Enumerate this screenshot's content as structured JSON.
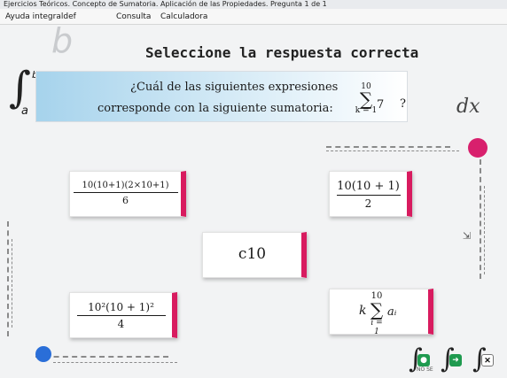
{
  "window": {
    "title": "Ejercicios Teóricos. Concepto de Sumatoria. Aplicación de las Propiedades. Pregunta 1 de 1"
  },
  "menu": {
    "items": [
      "Ayuda integraldef",
      "Consulta",
      "Calculadora"
    ]
  },
  "decor": {
    "letter_b": "b",
    "integral_lower": "a",
    "integral_upper": "b",
    "dx": "dx"
  },
  "header": "Seleccione la respuesta correcta",
  "question": {
    "line1": "¿Cuál de las siguientes expresiones",
    "line2": "corresponde con la siguiente sumatoria:",
    "sum_upper": "10",
    "sum_symbol": "∑",
    "sum_lower": "k = 1",
    "sum_term": "7",
    "mark": "?"
  },
  "options": [
    {
      "numerator": "10(10+1)(2×10+1)",
      "denominator": "6"
    },
    {
      "numerator": "10(10 + 1)",
      "denominator": "2"
    },
    {
      "text": "c10"
    },
    {
      "numerator": "10²(10 + 1)²",
      "denominator": "4"
    },
    {
      "prefix": "k",
      "upper": "10",
      "symbol": "∑",
      "lower": "i = 1",
      "term": "aᵢ"
    }
  ],
  "footer": {
    "buttons": [
      {
        "name": "check",
        "badge": "●"
      },
      {
        "name": "next",
        "badge": "➜"
      },
      {
        "name": "close",
        "badge": "✕"
      }
    ],
    "sub_label": "NO SE"
  },
  "colors": {
    "accent": "#d81b5f",
    "question_bg": "#a6d3ec",
    "blue_dot": "#2a6ed8",
    "green": "#1f9a4f"
  }
}
